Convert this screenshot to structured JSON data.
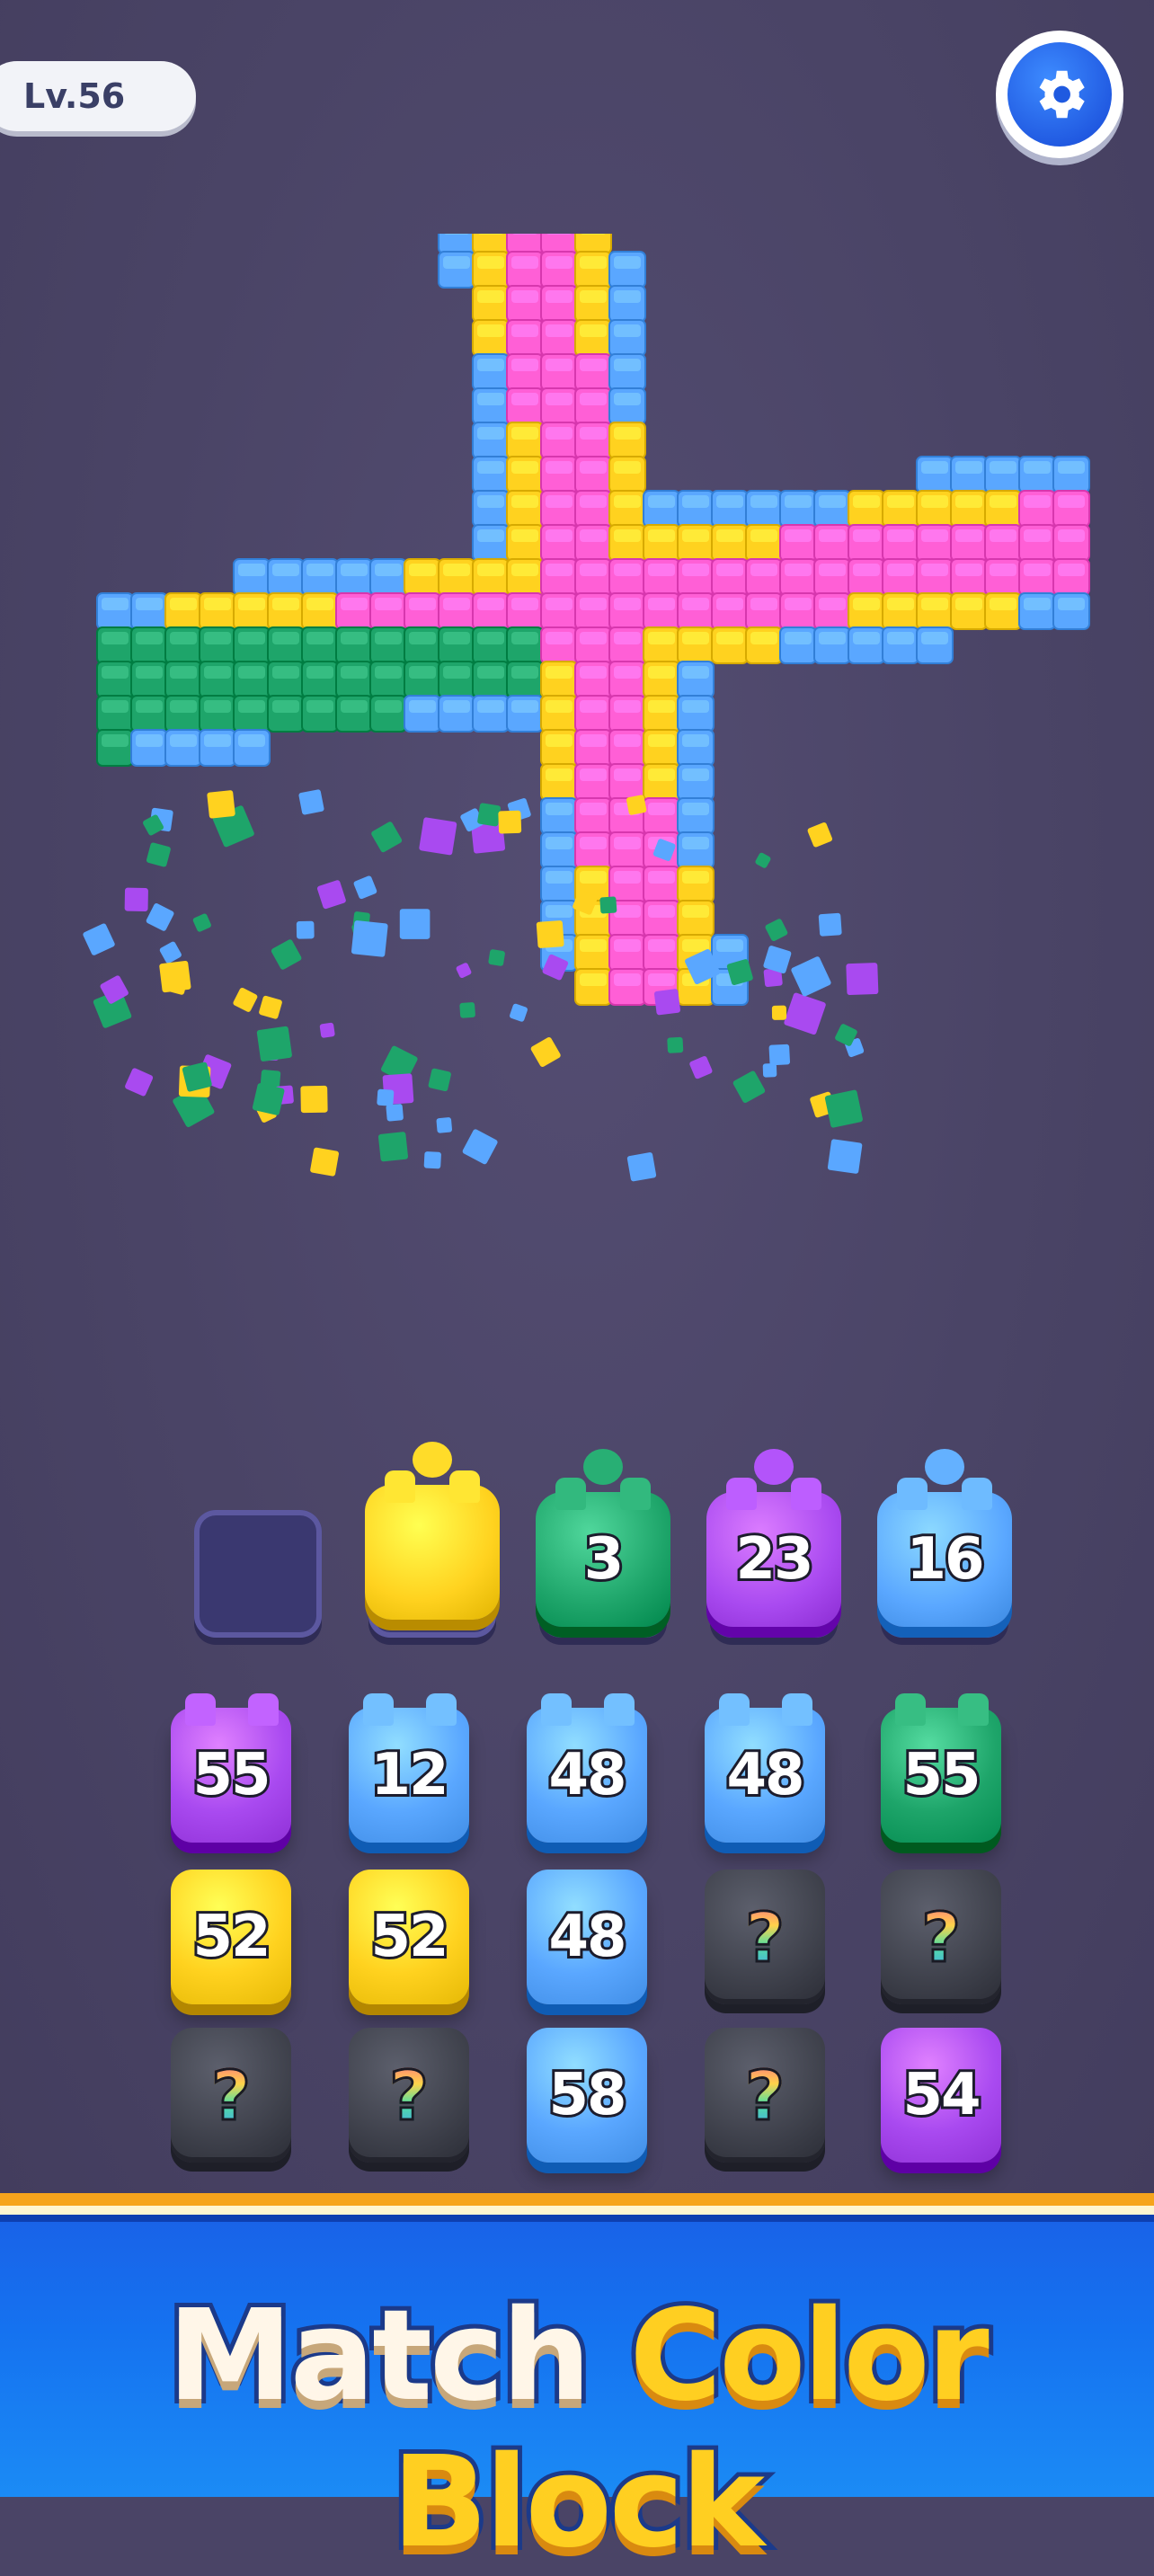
{
  "hud": {
    "level_label": "Lv.56",
    "settings_icon": "gear-icon"
  },
  "tray": {
    "slots": [
      {
        "state": "empty"
      },
      {
        "state": "filled",
        "color": "#ffd21f",
        "count": ""
      },
      {
        "state": "filled",
        "color": "#1ea56a",
        "count": "3"
      },
      {
        "state": "filled",
        "color": "#a94af0",
        "count": "23"
      },
      {
        "state": "filled",
        "color": "#5aa7ff",
        "count": "16"
      }
    ]
  },
  "grid": {
    "rows": [
      [
        {
          "type": "color",
          "color": "#a94af0",
          "count": "55"
        },
        {
          "type": "color",
          "color": "#5aa7ff",
          "count": "12"
        },
        {
          "type": "color",
          "color": "#5aa7ff",
          "count": "48"
        },
        {
          "type": "color",
          "color": "#5aa7ff",
          "count": "48"
        },
        {
          "type": "color",
          "color": "#1ea56a",
          "count": "55"
        }
      ],
      [
        {
          "type": "color",
          "color": "#ffd21f",
          "count": "52"
        },
        {
          "type": "color",
          "color": "#ffd21f",
          "count": "52"
        },
        {
          "type": "color",
          "color": "#5aa7ff",
          "count": "48"
        },
        {
          "type": "mystery",
          "label": "?"
        },
        {
          "type": "mystery",
          "label": "?"
        }
      ],
      [
        {
          "type": "mystery",
          "label": "?"
        },
        {
          "type": "mystery",
          "label": "?"
        },
        {
          "type": "color",
          "color": "#5aa7ff",
          "count": "58"
        },
        {
          "type": "mystery",
          "label": "?"
        },
        {
          "type": "color",
          "color": "#a94af0",
          "count": "54"
        }
      ]
    ]
  },
  "banner": {
    "word1": "Match",
    "word2": "Color Block"
  },
  "colors": {
    "background": "#4a4466",
    "pink": "#ff5fd6",
    "yellow": "#ffd21f",
    "blue": "#5aa7ff",
    "green": "#1ea56a",
    "purple": "#a94af0"
  }
}
